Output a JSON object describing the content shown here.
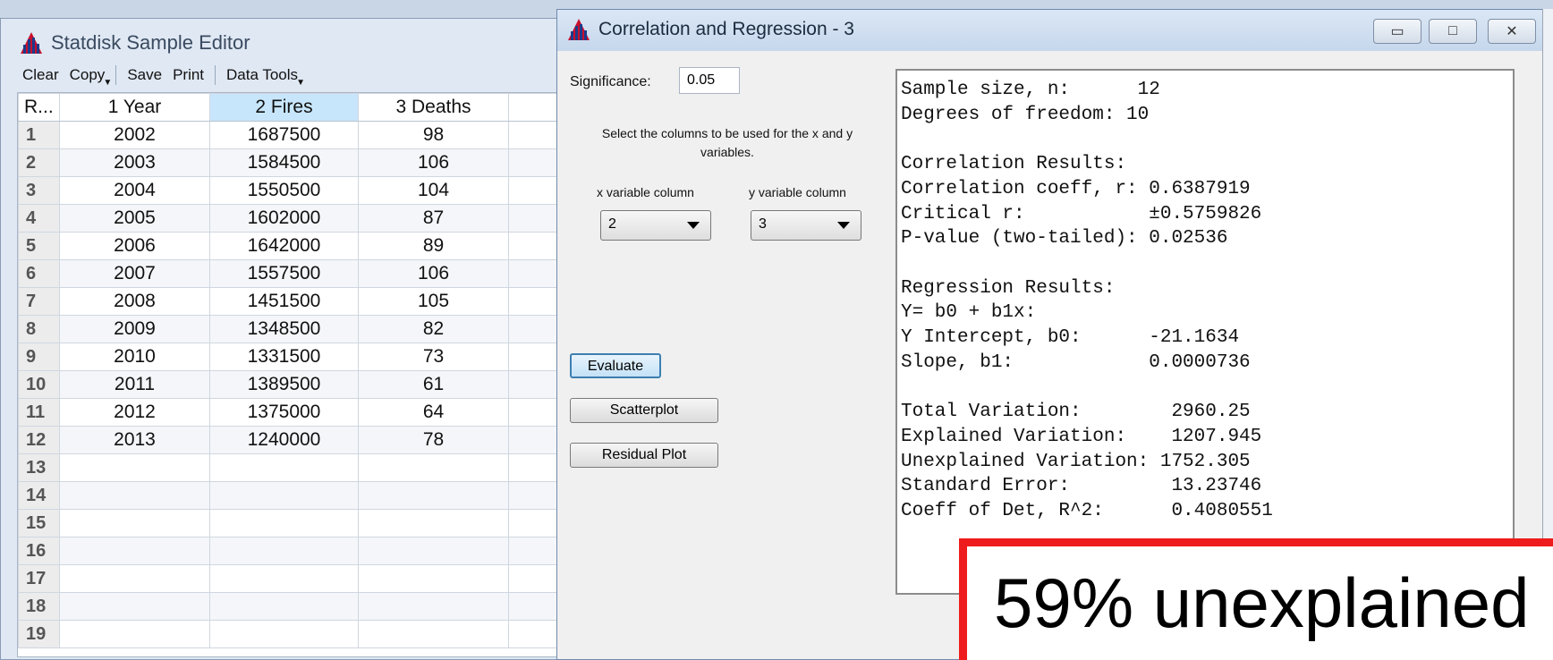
{
  "editor": {
    "title": "Statdisk Sample Editor",
    "toolbar": {
      "clear": "Clear",
      "copy": "Copy",
      "save": "Save",
      "print": "Print",
      "data_tools": "Data Tools"
    },
    "columns": [
      "R...",
      "1 Year",
      "2 Fires",
      "3 Deaths"
    ],
    "selected_column": "2 Fires",
    "rows": [
      {
        "num": "1",
        "year": "2002",
        "fires": "1687500",
        "deaths": "98"
      },
      {
        "num": "2",
        "year": "2003",
        "fires": "1584500",
        "deaths": "106"
      },
      {
        "num": "3",
        "year": "2004",
        "fires": "1550500",
        "deaths": "104"
      },
      {
        "num": "4",
        "year": "2005",
        "fires": "1602000",
        "deaths": "87"
      },
      {
        "num": "5",
        "year": "2006",
        "fires": "1642000",
        "deaths": "89"
      },
      {
        "num": "6",
        "year": "2007",
        "fires": "1557500",
        "deaths": "106"
      },
      {
        "num": "7",
        "year": "2008",
        "fires": "1451500",
        "deaths": "105"
      },
      {
        "num": "8",
        "year": "2009",
        "fires": "1348500",
        "deaths": "82"
      },
      {
        "num": "9",
        "year": "2010",
        "fires": "1331500",
        "deaths": "73"
      },
      {
        "num": "10",
        "year": "2011",
        "fires": "1389500",
        "deaths": "61"
      },
      {
        "num": "11",
        "year": "2012",
        "fires": "1375000",
        "deaths": "64"
      },
      {
        "num": "12",
        "year": "2013",
        "fires": "1240000",
        "deaths": "78"
      },
      {
        "num": "13",
        "year": "",
        "fires": "",
        "deaths": ""
      },
      {
        "num": "14",
        "year": "",
        "fires": "",
        "deaths": ""
      },
      {
        "num": "15",
        "year": "",
        "fires": "",
        "deaths": ""
      },
      {
        "num": "16",
        "year": "",
        "fires": "",
        "deaths": ""
      },
      {
        "num": "17",
        "year": "",
        "fires": "",
        "deaths": ""
      },
      {
        "num": "18",
        "year": "",
        "fires": "",
        "deaths": ""
      },
      {
        "num": "19",
        "year": "",
        "fires": "",
        "deaths": ""
      }
    ]
  },
  "corr": {
    "title": "Correlation and Regression - 3",
    "significance_label": "Significance:",
    "significance_value": "0.05",
    "select_instructions": "Select the columns to be used for the x and y variables.",
    "x_label": "x variable column",
    "y_label": "y variable column",
    "x_value": "2",
    "y_value": "3",
    "evaluate": "Evaluate",
    "scatterplot": "Scatterplot",
    "residual_plot": "Residual Plot",
    "results_text": "Sample size, n:      12\nDegrees of freedom: 10\n\nCorrelation Results:\nCorrelation coeff, r: 0.6387919\nCritical r:           ±0.5759826\nP-value (two-tailed): 0.02536\n\nRegression Results:\nY= b0 + b1x:\nY Intercept, b0:      -21.1634\nSlope, b1:            0.0000736\n\nTotal Variation:        2960.25\nExplained Variation:    1207.945\nUnexplained Variation: 1752.305\nStandard Error:         13.23746\nCoeff of Det, R^2:      0.4080551"
  },
  "callout": {
    "text": "59% unexplained",
    "border_color": "#ee1c1c"
  },
  "icons": [
    "statdisk-logo-icon",
    "minimize-icon",
    "maximize-icon",
    "close-icon",
    "chevron-down-icon"
  ]
}
